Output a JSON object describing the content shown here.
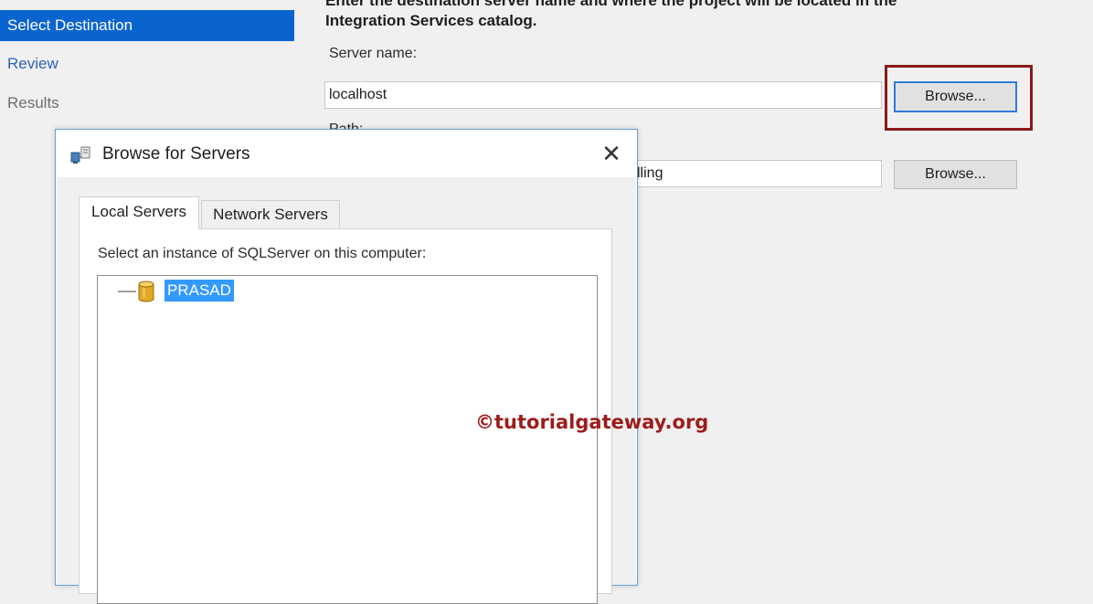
{
  "nav": {
    "items": [
      {
        "label": "Select Destination",
        "state": "selected"
      },
      {
        "label": "Review",
        "state": "link"
      },
      {
        "label": "Results",
        "state": "disabled"
      }
    ]
  },
  "main": {
    "instruction_line1": "Enter the destination server name and where the project will be located in the",
    "instruction_line2": "Integration Services catalog.",
    "server_label": "Server name:",
    "server_value": "localhost",
    "path_label": "Path:",
    "path_value": "lling",
    "browse_label": "Browse..."
  },
  "dialog": {
    "title": "Browse for Servers",
    "close_glyph": "✕",
    "tabs": [
      {
        "label": "Local Servers",
        "active": true
      },
      {
        "label": "Network Servers",
        "active": false
      }
    ],
    "panel_label": "Select an instance of SQLServer on this computer:",
    "tree_items": [
      {
        "label": "PRASAD",
        "selected": true
      }
    ]
  },
  "watermark": "©tutorialgateway.org",
  "colors": {
    "selection": "#0a64cf",
    "tree_selection": "#3399ff",
    "highlight_border": "#8b1a1a",
    "watermark": "#9c1c1c",
    "link": "#2f63b7"
  },
  "icons": [
    "server-network-icon",
    "database-icon",
    "close-icon"
  ]
}
